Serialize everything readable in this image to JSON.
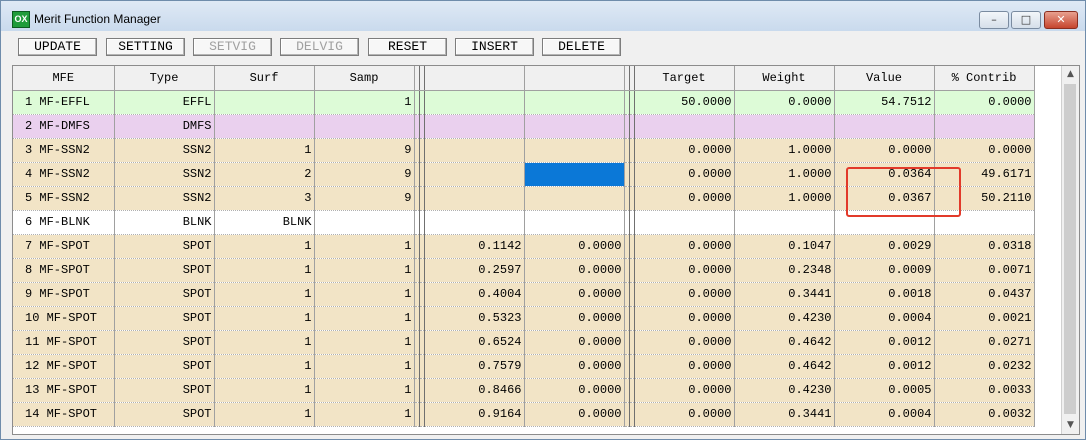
{
  "window": {
    "title": "Merit Function Manager",
    "app_icon": "OX"
  },
  "window_controls": {
    "minimize": "–",
    "maximize": "□",
    "close": "✕"
  },
  "toolbar": {
    "buttons": [
      {
        "label": "UPDATE",
        "enabled": true
      },
      {
        "label": "SETTING",
        "enabled": true
      },
      {
        "label": "SETVIG",
        "enabled": false
      },
      {
        "label": "DELVIG",
        "enabled": false
      },
      {
        "label": "RESET",
        "enabled": true
      },
      {
        "label": "INSERT",
        "enabled": true
      },
      {
        "label": "DELETE",
        "enabled": true
      }
    ]
  },
  "table": {
    "columns": [
      "MFE",
      "Type",
      "Surf",
      "Samp",
      "",
      "",
      "Target",
      "Weight",
      "Value",
      "% Contrib"
    ],
    "rows": [
      {
        "kind": "effl",
        "mfe": "1 MF-EFFL",
        "type": "EFFL",
        "surf": "",
        "samp": "1",
        "p1": "",
        "p2": "",
        "target": "50.0000",
        "weight": "0.0000",
        "value": "54.7512",
        "contrib": "0.0000"
      },
      {
        "kind": "dmfs",
        "mfe": "2 MF-DMFS",
        "type": "DMFS",
        "surf": "",
        "samp": "",
        "p1": "",
        "p2": "",
        "target": "",
        "weight": "",
        "value": "",
        "contrib": ""
      },
      {
        "kind": "ssn2",
        "mfe": "3 MF-SSN2",
        "type": "SSN2",
        "surf": "1",
        "samp": "9",
        "p1": "",
        "p2": "",
        "target": "0.0000",
        "weight": "1.0000",
        "value": "0.0000",
        "contrib": "0.0000"
      },
      {
        "kind": "ssn2",
        "mfe": "4 MF-SSN2",
        "type": "SSN2",
        "surf": "2",
        "samp": "9",
        "p1": "",
        "p2": "",
        "target": "0.0000",
        "weight": "1.0000",
        "value": "0.0364",
        "contrib": "49.6171",
        "selected_col": "p2"
      },
      {
        "kind": "ssn2",
        "mfe": "5 MF-SSN2",
        "type": "SSN2",
        "surf": "3",
        "samp": "9",
        "p1": "",
        "p2": "",
        "target": "0.0000",
        "weight": "1.0000",
        "value": "0.0367",
        "contrib": "50.2110"
      },
      {
        "kind": "blnk",
        "mfe": "6 MF-BLNK",
        "type": "BLNK",
        "surf": "BLNK",
        "samp": "",
        "p1": "",
        "p2": "",
        "target": "",
        "weight": "",
        "value": "",
        "contrib": ""
      },
      {
        "kind": "spot",
        "mfe": "7 MF-SPOT",
        "type": "SPOT",
        "surf": "1",
        "samp": "1",
        "p1": "0.1142",
        "p2": "0.0000",
        "target": "0.0000",
        "weight": "0.1047",
        "value": "0.0029",
        "contrib": "0.0318"
      },
      {
        "kind": "spot",
        "mfe": "8 MF-SPOT",
        "type": "SPOT",
        "surf": "1",
        "samp": "1",
        "p1": "0.2597",
        "p2": "0.0000",
        "target": "0.0000",
        "weight": "0.2348",
        "value": "0.0009",
        "contrib": "0.0071"
      },
      {
        "kind": "spot",
        "mfe": "9 MF-SPOT",
        "type": "SPOT",
        "surf": "1",
        "samp": "1",
        "p1": "0.4004",
        "p2": "0.0000",
        "target": "0.0000",
        "weight": "0.3441",
        "value": "0.0018",
        "contrib": "0.0437"
      },
      {
        "kind": "spot",
        "mfe": "10 MF-SPOT",
        "type": "SPOT",
        "surf": "1",
        "samp": "1",
        "p1": "0.5323",
        "p2": "0.0000",
        "target": "0.0000",
        "weight": "0.4230",
        "value": "0.0004",
        "contrib": "0.0021"
      },
      {
        "kind": "spot",
        "mfe": "11 MF-SPOT",
        "type": "SPOT",
        "surf": "1",
        "samp": "1",
        "p1": "0.6524",
        "p2": "0.0000",
        "target": "0.0000",
        "weight": "0.4642",
        "value": "0.0012",
        "contrib": "0.0271"
      },
      {
        "kind": "spot",
        "mfe": "12 MF-SPOT",
        "type": "SPOT",
        "surf": "1",
        "samp": "1",
        "p1": "0.7579",
        "p2": "0.0000",
        "target": "0.0000",
        "weight": "0.4642",
        "value": "0.0012",
        "contrib": "0.0232"
      },
      {
        "kind": "spot",
        "mfe": "13 MF-SPOT",
        "type": "SPOT",
        "surf": "1",
        "samp": "1",
        "p1": "0.8466",
        "p2": "0.0000",
        "target": "0.0000",
        "weight": "0.4230",
        "value": "0.0005",
        "contrib": "0.0033"
      },
      {
        "kind": "spot",
        "mfe": "14 MF-SPOT",
        "type": "SPOT",
        "surf": "1",
        "samp": "1",
        "p1": "0.9164",
        "p2": "0.0000",
        "target": "0.0000",
        "weight": "0.3441",
        "value": "0.0004",
        "contrib": "0.0032"
      }
    ]
  },
  "scrollbar": {
    "up": "▲",
    "down": "▼"
  },
  "colors": {
    "effl_row": "#ddfbd7",
    "dmfs_row": "#ead0ee",
    "ssn2_row": "#f2e4c6",
    "selection": "#0b78d7",
    "highlight": "#e23a2a"
  }
}
